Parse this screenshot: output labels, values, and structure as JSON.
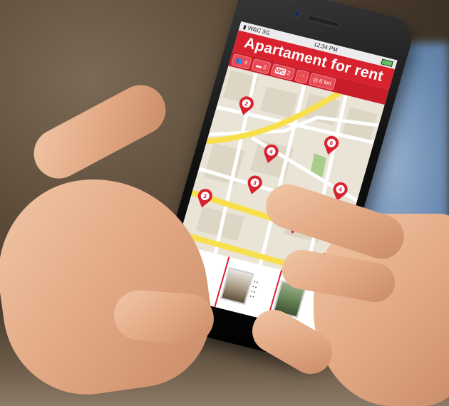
{
  "statusbar": {
    "carrier": "W&C",
    "network": "3G",
    "time": "12:34 PM"
  },
  "app": {
    "title": "Apartament for rent"
  },
  "filters": [
    {
      "icon": "people-icon",
      "value": "4"
    },
    {
      "icon": "bed-icon",
      "value": "2"
    },
    {
      "icon": "wc-icon",
      "label": "WC",
      "value": "2"
    },
    {
      "icon": "wifi-icon",
      "value": ""
    },
    {
      "icon": "location-icon",
      "value": "6 km"
    }
  ],
  "map": {
    "buttons": {
      "zoom_in": "+"
    },
    "pins": [
      {
        "number": "2"
      },
      {
        "number": "4"
      },
      {
        "number": "3"
      },
      {
        "number": "6"
      },
      {
        "number": "4"
      },
      {
        "number": "2"
      },
      {
        "number": "3"
      }
    ]
  },
  "colors": {
    "brand": "#d8232f",
    "road": "#f7e04b",
    "park": "#a8cc8a"
  }
}
